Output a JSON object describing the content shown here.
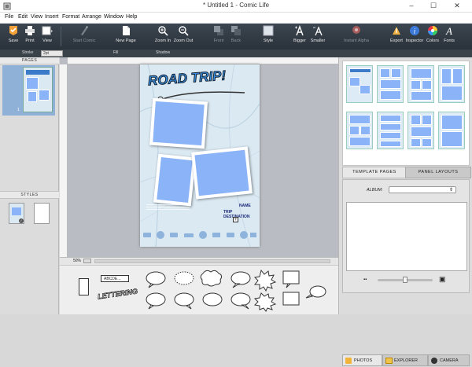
{
  "window": {
    "title": "* Untitled 1 - Comic Life",
    "min": "–",
    "max": "☐",
    "close": "✕"
  },
  "menu": [
    "File",
    "Edit",
    "View",
    "Insert",
    "Format",
    "Arrange",
    "Window",
    "Help"
  ],
  "toolbar": {
    "save": "Save",
    "print": "Print",
    "view": "View",
    "start_comic": "Start Comic",
    "new_page": "New Page",
    "zoom_in": "Zoom In",
    "zoom_out": "Zoom Out",
    "front": "Front",
    "back": "Back",
    "style": "Style",
    "bigger": "Bigger",
    "smaller": "Smaller",
    "instant_alpha": "Instant Alpha",
    "export": "Export",
    "inspector": "Inspector",
    "colors": "Colors",
    "fonts": "Fonts"
  },
  "propbar": {
    "stroke_label": "Stroke",
    "stroke_value": "2pt",
    "fill_label": "Fill",
    "shadow_label": "Shadow"
  },
  "left": {
    "pages_header": "PAGES",
    "page_number": "1",
    "styles_header": "STYLES"
  },
  "page": {
    "title_art": "ROAD TRIP!",
    "text_name": "NAME",
    "text_dest": "TRIP DESTINATION"
  },
  "status": {
    "zoom": "50%"
  },
  "balloons": {
    "lettering_art": "LETTERING",
    "caption": "ABCDE..."
  },
  "right": {
    "tab_templates": "TEMPLATE PAGES",
    "tab_layouts": "PANEL LAYOUTS",
    "album_label": "ALBUM:"
  },
  "bottom_tabs": {
    "photos": "PHOTOS",
    "explorer": "EXPLORER",
    "camera": "CAMERA"
  }
}
